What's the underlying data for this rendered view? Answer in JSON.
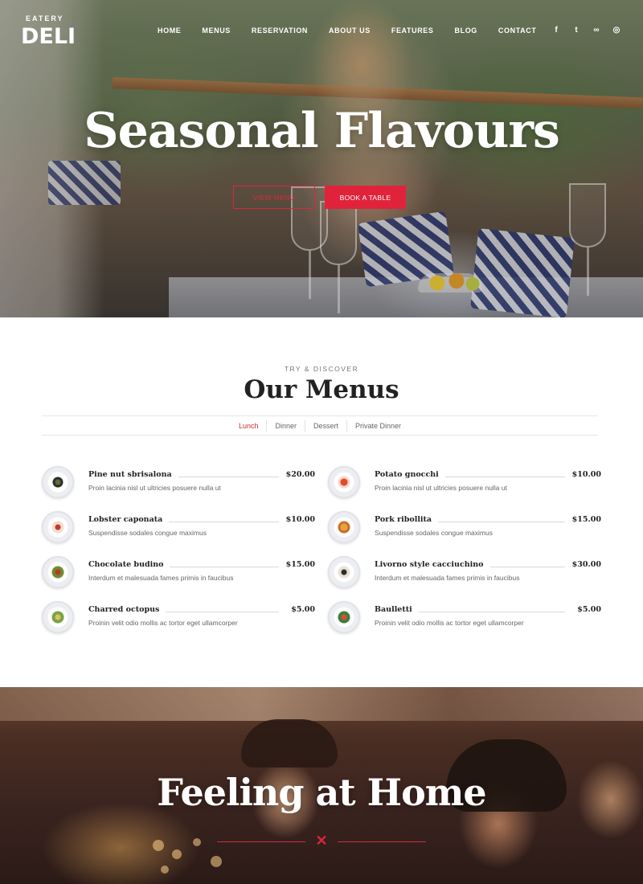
{
  "header": {
    "logo_top": "EATERY",
    "logo_main": "DELI",
    "nav": [
      "HOME",
      "MENUS",
      "RESERVATION",
      "ABOUT US",
      "FEATURES",
      "BLOG",
      "CONTACT"
    ],
    "socials": [
      {
        "icon": "facebook-icon",
        "glyph": "f"
      },
      {
        "icon": "twitter-icon",
        "glyph": "t"
      },
      {
        "icon": "tripadvisor-icon",
        "glyph": "∞"
      },
      {
        "icon": "instagram-icon",
        "glyph": "◎"
      }
    ]
  },
  "hero": {
    "title": "Seasonal Flavours",
    "view_menu": "VIEW MENU",
    "book_table": "BOOK A TABLE"
  },
  "menus": {
    "eyebrow": "TRY & DISCOVER",
    "title": "Our Menus",
    "tabs": [
      "Lunch",
      "Dinner",
      "Dessert",
      "Private Dinner"
    ],
    "active_tab": "Lunch",
    "items": [
      {
        "name": "Pine nut sbrisalona",
        "price": "$20.00",
        "desc": "Proin lacinia nisl ut ultricies posuere nulla ut"
      },
      {
        "name": "Potato gnocchi",
        "price": "$10.00",
        "desc": "Proin lacinia nisl ut ultricies posuere nulla ut"
      },
      {
        "name": "Lobster caponata",
        "price": "$10.00",
        "desc": "Suspendisse sodales congue maximus"
      },
      {
        "name": "Pork ribollita",
        "price": "$15.00",
        "desc": "Suspendisse sodales congue maximus"
      },
      {
        "name": "Chocolate budino",
        "price": "$15.00",
        "desc": "Interdum et malesuada fames primis in faucibus"
      },
      {
        "name": "Livorno style cacciuchino",
        "price": "$30.00",
        "desc": "Interdum et malesuada fames primis in faucibus"
      },
      {
        "name": "Charred octopus",
        "price": "$5.00",
        "desc": "Proinin velit odio mollis ac tortor eget ullamcorper"
      },
      {
        "name": "Baulletti",
        "price": "$5.00",
        "desc": "Proinin velit odio mollis ac tortor eget ullamcorper"
      }
    ]
  },
  "home": {
    "title": "Feeling at Home",
    "divider_icon": "cutlery-icon"
  },
  "colors": {
    "accent": "#e0233b",
    "active_tab": "#c4313e"
  }
}
